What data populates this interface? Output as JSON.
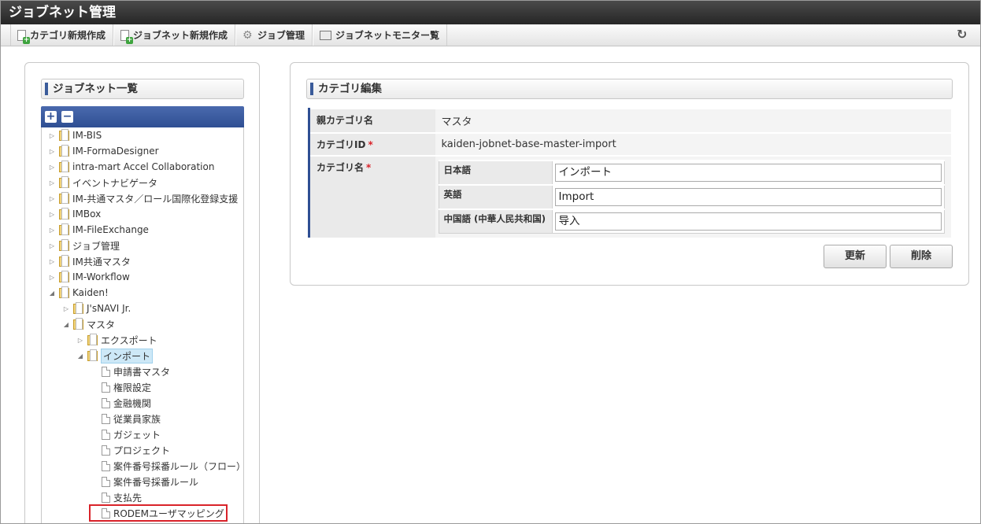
{
  "app": {
    "title": "ジョブネット管理"
  },
  "toolbar": {
    "items": [
      {
        "label": "カテゴリ新規作成"
      },
      {
        "label": "ジョブネット新規作成"
      },
      {
        "label": "ジョブ管理"
      },
      {
        "label": "ジョブネットモニター覧"
      }
    ]
  },
  "left": {
    "section_title": "ジョブネット一覧",
    "tree": [
      {
        "label": "IM-BIS",
        "expanded": false,
        "type": "folder"
      },
      {
        "label": "IM-FormaDesigner",
        "expanded": false,
        "type": "folder"
      },
      {
        "label": "intra-mart Accel Collaboration",
        "expanded": false,
        "type": "folder"
      },
      {
        "label": "イベントナビゲータ",
        "expanded": false,
        "type": "folder"
      },
      {
        "label": "IM-共通マスタ／ロール国際化登録支援",
        "expanded": false,
        "type": "folder"
      },
      {
        "label": "IMBox",
        "expanded": false,
        "type": "folder"
      },
      {
        "label": "IM-FileExchange",
        "expanded": false,
        "type": "folder"
      },
      {
        "label": "ジョブ管理",
        "expanded": false,
        "type": "folder"
      },
      {
        "label": "IM共通マスタ",
        "expanded": false,
        "type": "folder"
      },
      {
        "label": "IM-Workflow",
        "expanded": false,
        "type": "folder"
      },
      {
        "label": "Kaiden!",
        "expanded": true,
        "type": "folder"
      },
      {
        "label": "J'sNAVI Jr.",
        "expanded": false,
        "type": "folder"
      },
      {
        "label": "マスタ",
        "expanded": true,
        "type": "folder"
      },
      {
        "label": "エクスポート",
        "expanded": false,
        "type": "folder"
      },
      {
        "label": "インポート",
        "expanded": true,
        "type": "folder",
        "selected": true
      },
      {
        "label": "申請書マスタ",
        "type": "doc"
      },
      {
        "label": "権限設定",
        "type": "doc"
      },
      {
        "label": "金融機関",
        "type": "doc"
      },
      {
        "label": "従業員家族",
        "type": "doc"
      },
      {
        "label": "ガジェット",
        "type": "doc"
      },
      {
        "label": "プロジェクト",
        "type": "doc"
      },
      {
        "label": "案件番号採番ルール（フロー）",
        "type": "doc"
      },
      {
        "label": "案件番号採番ルール",
        "type": "doc"
      },
      {
        "label": "支払先",
        "type": "doc"
      },
      {
        "label": "RODEMユーザマッピング",
        "type": "doc",
        "highlighted": true
      }
    ]
  },
  "right": {
    "section_title": "カテゴリ編集",
    "fields": {
      "parent_label": "親カテゴリ名",
      "parent_value": "マスタ",
      "id_label": "カテゴリID",
      "id_value": "kaiden-jobnet-base-master-import",
      "name_label": "カテゴリ名",
      "required_mark": "*"
    },
    "names": [
      {
        "lang": "日本語",
        "value": "インポート"
      },
      {
        "lang": "英語",
        "value": "Import"
      },
      {
        "lang": "中国語 (中華人民共和国)",
        "value": "导入"
      }
    ],
    "update_label": "更新",
    "delete_label": "削除"
  }
}
